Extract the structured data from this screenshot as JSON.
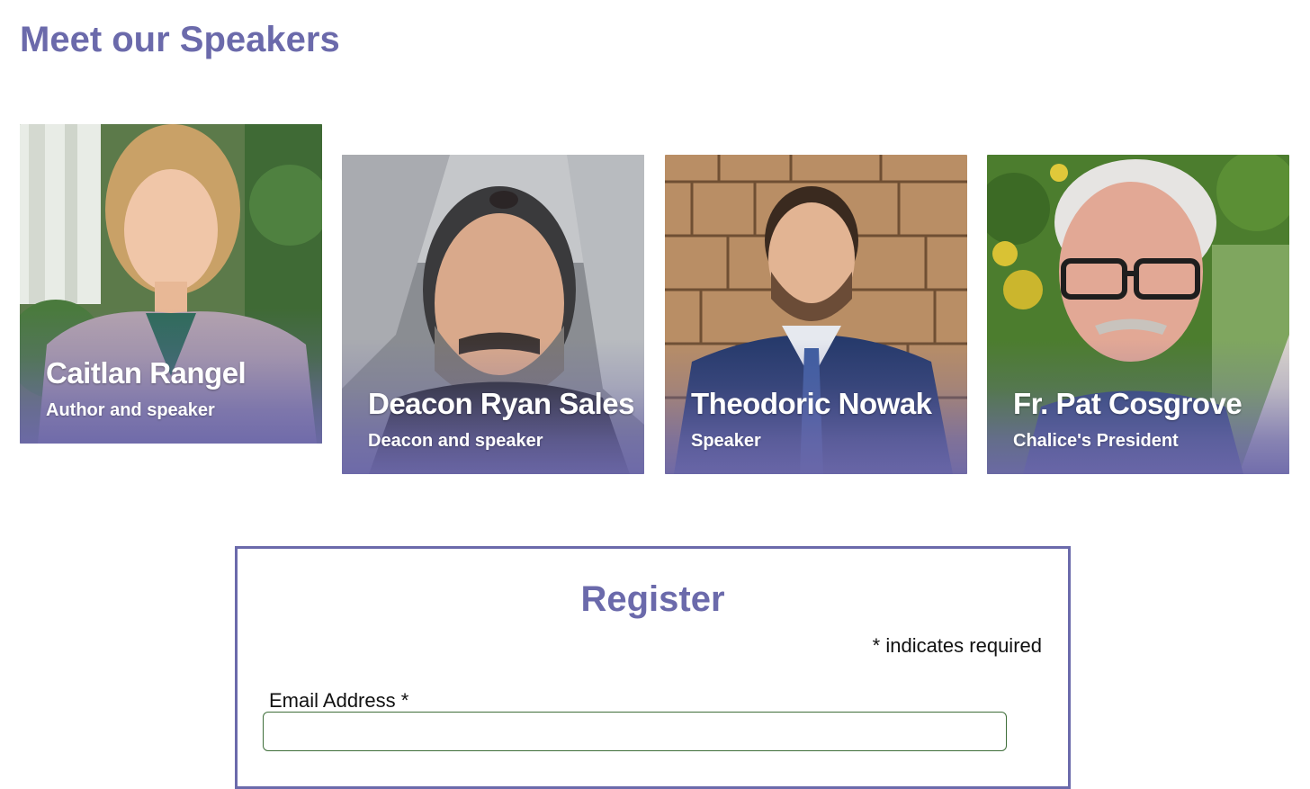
{
  "page": {
    "section_title": "Meet our Speakers"
  },
  "speakers": [
    {
      "name": "Caitlan Rangel",
      "role": "Author and speaker"
    },
    {
      "name": "Deacon Ryan Sales",
      "role": "Deacon and speaker"
    },
    {
      "name": "Theodoric Nowak",
      "role": "Speaker"
    },
    {
      "name": "Fr. Pat Cosgrove",
      "role": "Chalice's President"
    }
  ],
  "register": {
    "title": "Register",
    "required_note": "* indicates required",
    "email_label": "Email Address  *",
    "email_value": "",
    "email_placeholder": ""
  },
  "colors": {
    "accent": "#6b6aab",
    "input_border": "#3f6e3a"
  },
  "icons": {
    "speaker_photos": [
      "photo-woman-portrait",
      "photo-man-beard-portrait",
      "photo-man-suit-portrait",
      "photo-older-man-glasses-portrait"
    ]
  }
}
